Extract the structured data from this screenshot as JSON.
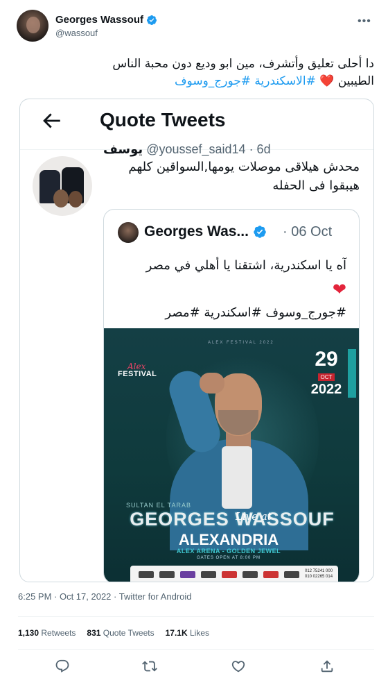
{
  "author": {
    "name": "Georges Wassouf",
    "handle": "@wassouf",
    "avatar_icon": "profile-photo"
  },
  "tweet": {
    "text_line1": "دا أحلى تعليق وأتشرف، مين ابو وديع دون محبة الناس",
    "text_line2_prefix": "الطيبين",
    "hashtags": "#الاسكندرية #جورج_وسوف",
    "heart": "❤️"
  },
  "screenshot": {
    "header_title": "Quote Tweets",
    "back_icon": "arrow-left-icon",
    "cut_handle_name": "يوسف",
    "cut_handle": "@youssef_said14 · 6d",
    "reply_text": "محدش هيلاقى موصلات يومها,السواقين كلهم هيبقوا فى الحفله",
    "quoted": {
      "name": "Georges Was...",
      "date": "· 06 Oct",
      "line1": "آه يا اسكندرية، اشتقنا يا أهلي في مصر",
      "heart": "❤",
      "hashtags": "#جورج_وسوف #اسكندرية #مصر"
    },
    "poster": {
      "festival_script": "Alex",
      "festival": "FESTIVAL",
      "alex_festival": "ALEX FESTIVAL 2022",
      "day": "29",
      "month": "OCT",
      "year": "2022",
      "sultan": "SULTAN EL TARAB",
      "artist": "GEORGES WASSOUF",
      "live": "Live at",
      "city": "ALEXANDRIA",
      "venue": "ALEX ARENA - GOLDEN JEWEL",
      "gates": "GATES OPEN AT 8:00 PM",
      "phone1": "012 75241 000",
      "phone2": "010 02265 014"
    }
  },
  "meta": {
    "timestamp": "6:25 PM · Oct 17, 2022 · Twitter for Android"
  },
  "stats": {
    "retweets_count": "1,130",
    "retweets_label": "Retweets",
    "quotes_count": "831",
    "quotes_label": "Quote Tweets",
    "likes_count": "17.1K",
    "likes_label": "Likes"
  },
  "colors": {
    "link": "#1d9bf0",
    "secondary_text": "#536471",
    "heart": "#e3243b",
    "poster_bg": "#0f3a3c"
  }
}
